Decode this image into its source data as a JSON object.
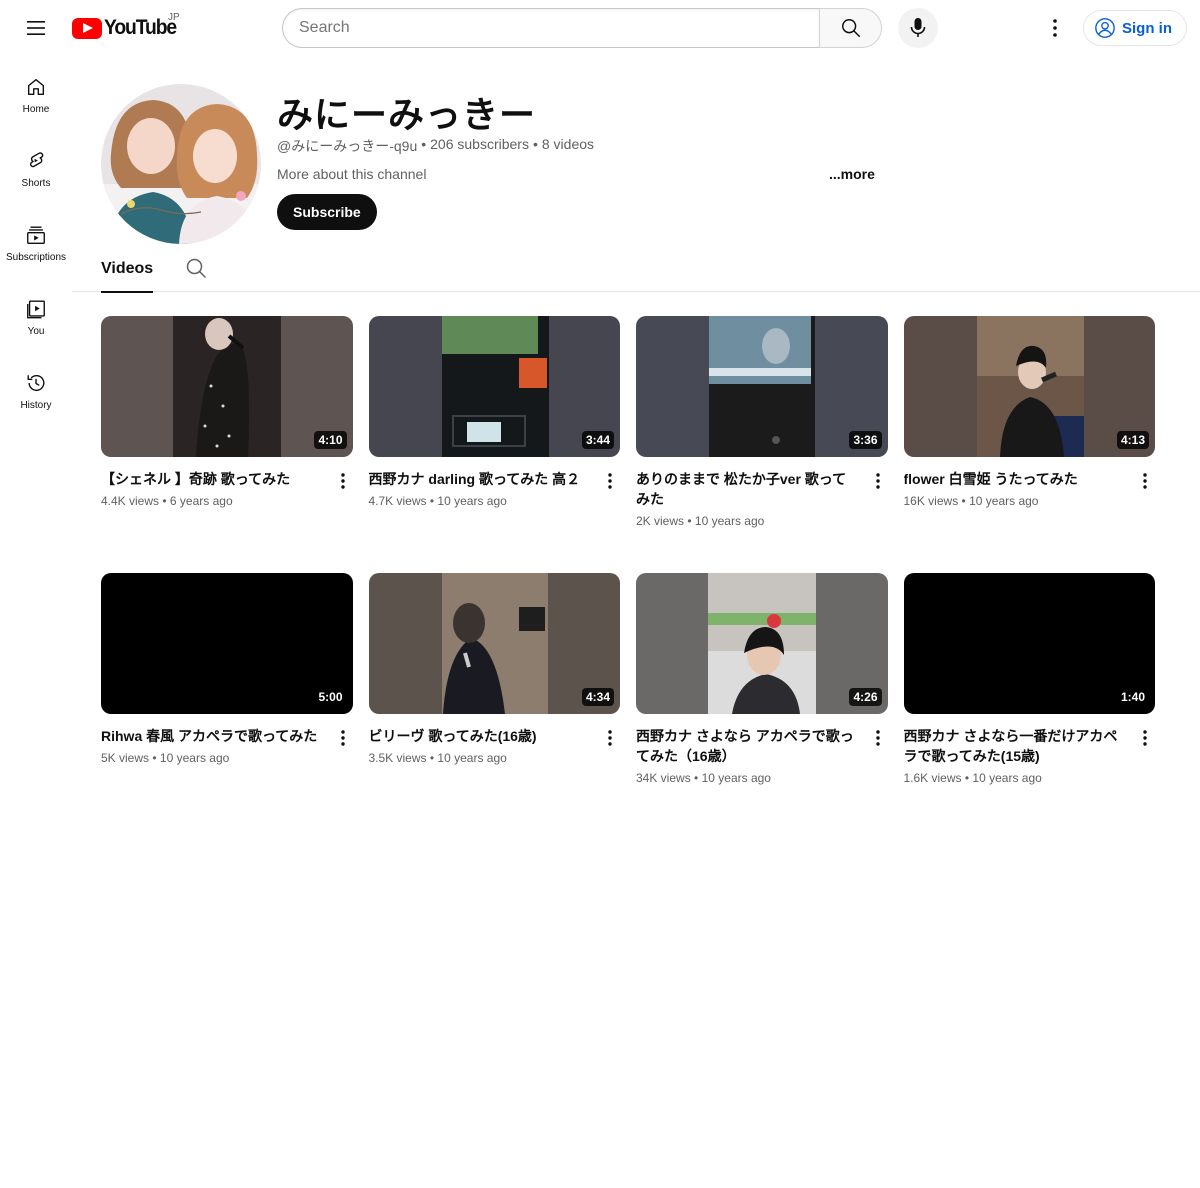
{
  "masthead": {
    "logo_text": "YouTube",
    "country": "JP",
    "search_placeholder": "Search",
    "sign_in": "Sign in"
  },
  "guide": [
    {
      "label": "Home",
      "icon": "home-icon"
    },
    {
      "label": "Shorts",
      "icon": "shorts-icon"
    },
    {
      "label": "Subscriptions",
      "icon": "subscriptions-icon"
    },
    {
      "label": "You",
      "icon": "you-icon"
    },
    {
      "label": "History",
      "icon": "history-icon"
    }
  ],
  "channel": {
    "title": "みにーみっきー",
    "handle": "@みにーみっきー-q9u",
    "subscribers": "206 subscribers",
    "videos": "8 videos",
    "separator": "•",
    "about": "More about this channel",
    "more": "...more",
    "subscribe": "Subscribe"
  },
  "tabs": {
    "videos": "Videos"
  },
  "videos": [
    {
      "title": "【シェネル 】奇跡 歌ってみた",
      "views": "4.4K views",
      "age": "6 years ago",
      "duration": "4:10"
    },
    {
      "title": "西野カナ darling 歌ってみた 高２",
      "views": "4.7K views",
      "age": "10 years ago",
      "duration": "3:44"
    },
    {
      "title": "ありのままで 松たか子ver 歌ってみた",
      "views": "2K views",
      "age": "10 years ago",
      "duration": "3:36"
    },
    {
      "title": "flower 白雪姫 うたってみた",
      "views": "16K views",
      "age": "10 years ago",
      "duration": "4:13"
    },
    {
      "title": "Rihwa 春風 アカペラで歌ってみた",
      "views": "5K views",
      "age": "10 years ago",
      "duration": "5:00"
    },
    {
      "title": "ビリーヴ 歌ってみた(16歳)",
      "views": "3.5K views",
      "age": "10 years ago",
      "duration": "4:34"
    },
    {
      "title": "西野カナ さよなら アカペラで歌ってみた（16歳）",
      "views": "34K views",
      "age": "10 years ago",
      "duration": "4:26"
    },
    {
      "title": "西野カナ さよなら一番だけアカペラで歌ってみた(15歳)",
      "views": "1.6K views",
      "age": "10 years ago",
      "duration": "1:40"
    }
  ],
  "colors": {
    "brand_red": "#ff0000",
    "link_blue": "#065fd4",
    "text_primary": "#0f0f0f",
    "text_secondary": "#606060"
  }
}
